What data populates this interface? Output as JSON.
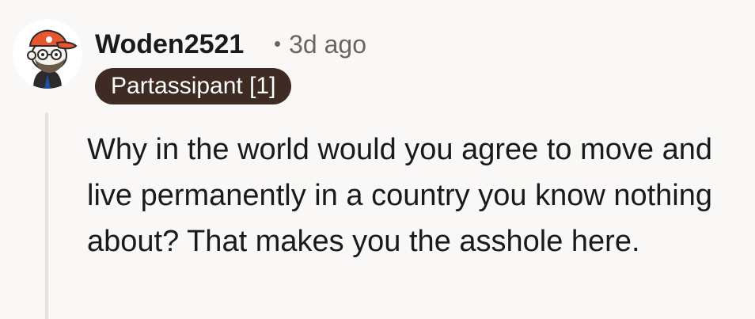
{
  "comment": {
    "author": "Woden2521",
    "separator": "•",
    "timestamp": "3d ago",
    "flair": "Partassipant [1]",
    "body": "Why in the world would you agree to move and live permanently in a country you know nothing about? That makes you the asshole here."
  },
  "colors": {
    "background": "#faf8f6",
    "flair_background": "#3d2b24",
    "flair_text": "#ffffff",
    "thread_line": "#ebe1da",
    "avatar_cap": "#e8552f"
  },
  "icons": {
    "avatar": "snoo-avatar-orange-cap"
  }
}
